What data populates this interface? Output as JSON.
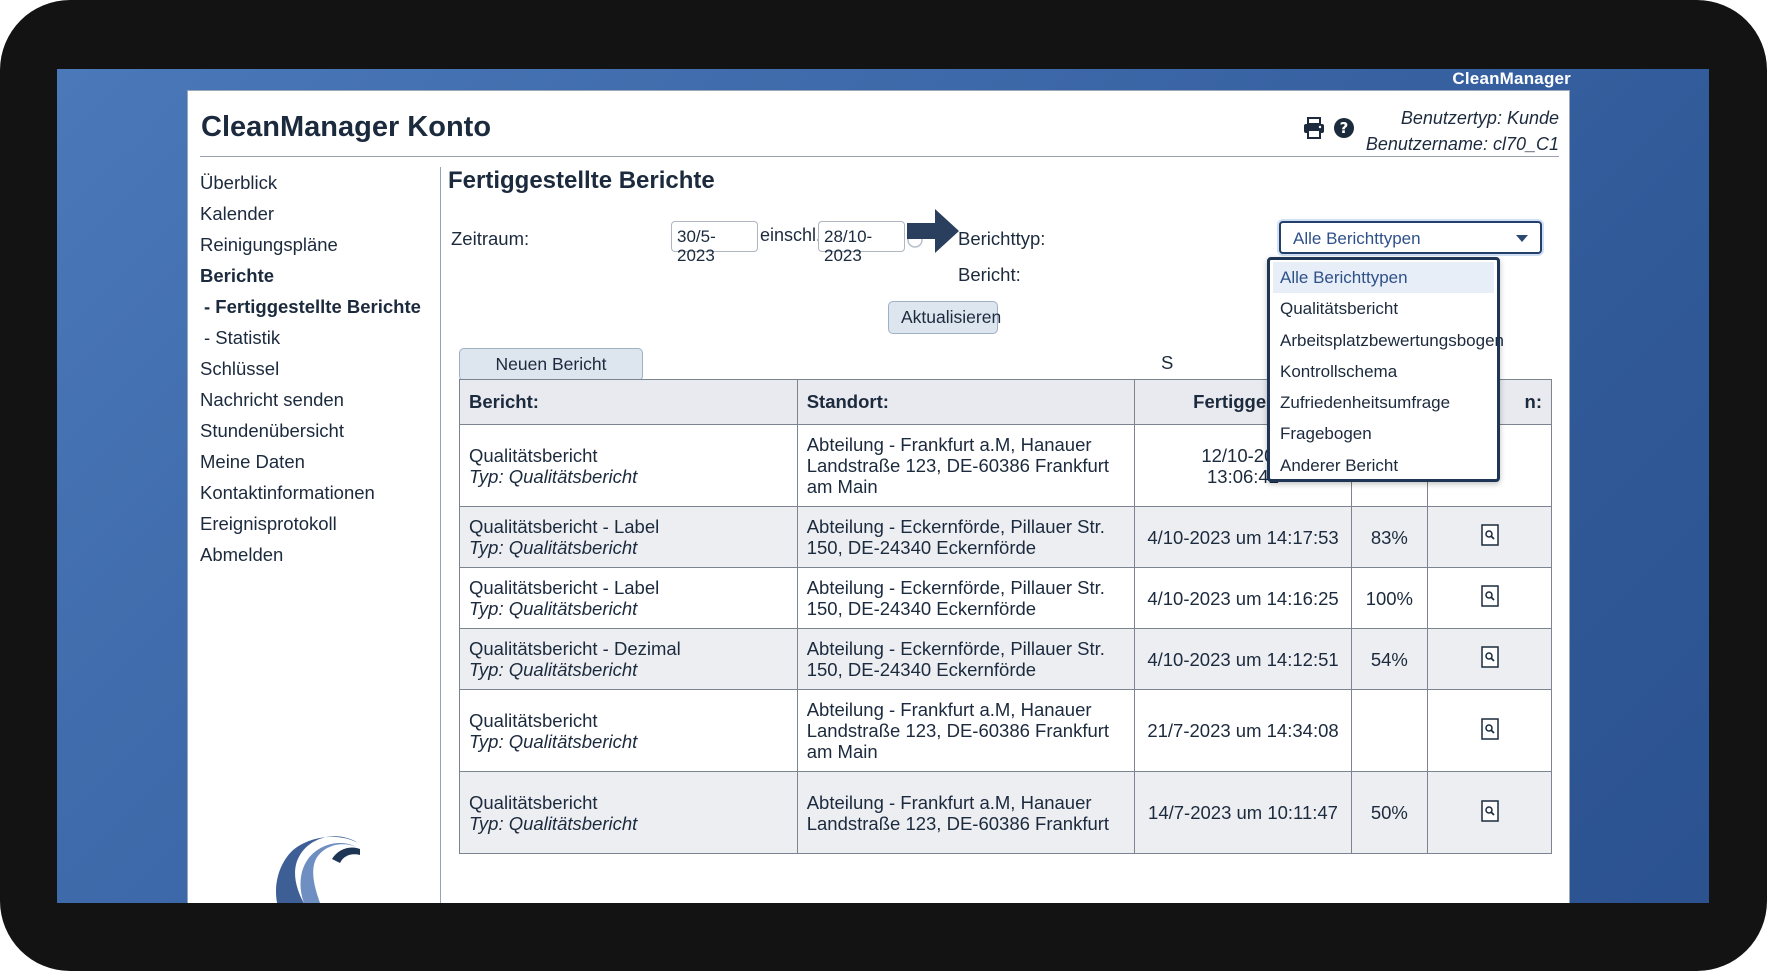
{
  "desktop": {
    "title": "CleanManager"
  },
  "header": {
    "title": "CleanManager Konto",
    "user_type": "Benutzertyp: Kunde",
    "username": "Benutzername: cl70_C1"
  },
  "sidebar": {
    "items": [
      {
        "label": "Überblick"
      },
      {
        "label": "Kalender"
      },
      {
        "label": "Reinigungspläne"
      },
      {
        "label": "Berichte"
      },
      {
        "label": "- Fertiggestellte Berichte"
      },
      {
        "label": "- Statistik"
      },
      {
        "label": "Schlüssel"
      },
      {
        "label": "Nachricht senden"
      },
      {
        "label": "Stundenübersicht"
      },
      {
        "label": "Meine Daten"
      },
      {
        "label": "Kontaktinformationen"
      },
      {
        "label": "Ereignisprotokoll"
      },
      {
        "label": "Abmelden"
      }
    ]
  },
  "main": {
    "title": "Fertiggestellte Berichte",
    "filters": {
      "period_label": "Zeitraum:",
      "date_from": "30/5-2023",
      "between": "einschl.",
      "date_to": "28/10-2023",
      "report_type_label": "Berichttyp:",
      "report_type_value": "Alle Berichttypen",
      "report_label": "Bericht:"
    },
    "update_button": "Aktualisieren",
    "new_report_button": "Neuen Bericht ausfüllen",
    "search_partial": "S",
    "dropdown_options": [
      "Alle Berichttypen",
      "Qualitätsbericht",
      "Arbeitsplatzbewertungsbogen",
      "Kontrollschema",
      "Zufriedenheitsumfrage",
      "Fragebogen",
      "Anderer Bericht"
    ],
    "table": {
      "headers": [
        "Bericht:",
        "Standort:",
        "Fertiggeste",
        "",
        "n:"
      ],
      "rows": [
        {
          "name": "Qualitätsbericht",
          "type": "Typ: Qualitätsbericht",
          "location": "Abteilung - Frankfurt a.M, Hanauer Landstraße 123, DE-60386 Frankfurt am Main",
          "date": "12/10-202",
          "time": "13:06:42",
          "score": ""
        },
        {
          "name": "Qualitätsbericht - Label",
          "type": "Typ: Qualitätsbericht",
          "location": "Abteilung - Eckernförde, Pillauer Str. 150, DE-24340 Eckernförde",
          "date": "4/10-2023 um 14:17:53",
          "score": "83%"
        },
        {
          "name": "Qualitätsbericht - Label",
          "type": "Typ: Qualitätsbericht",
          "location": "Abteilung - Eckernförde, Pillauer Str. 150, DE-24340 Eckernförde",
          "date": "4/10-2023 um 14:16:25",
          "score": "100%"
        },
        {
          "name": "Qualitätsbericht - Dezimal",
          "type": "Typ: Qualitätsbericht",
          "location": "Abteilung - Eckernförde, Pillauer Str. 150, DE-24340 Eckernförde",
          "date": "4/10-2023 um 14:12:51",
          "score": "54%"
        },
        {
          "name": "Qualitätsbericht",
          "type": "Typ: Qualitätsbericht",
          "location": "Abteilung - Frankfurt a.M, Hanauer Landstraße 123, DE-60386 Frankfurt am Main",
          "date": "21/7-2023 um 14:34:08",
          "score": ""
        },
        {
          "name": "Qualitätsbericht",
          "type": "Typ: Qualitätsbericht",
          "location": "Abteilung - Frankfurt a.M, Hanauer Landstraße 123, DE-60386 Frankfurt",
          "date": "14/7-2023 um 10:11:47",
          "score": "50%"
        }
      ]
    }
  },
  "colors": {
    "desktop_bg": "#3c67a8",
    "header_bg": "#e8eaef",
    "alt_row": "#eceef2",
    "accent": "#2f5189",
    "dropdown_border": "#1f3556"
  },
  "icons": [
    "printer-icon",
    "help-icon",
    "clear-date-icon",
    "arrow-right-icon",
    "refresh-icon",
    "view-report-icon",
    "logo-icon"
  ]
}
